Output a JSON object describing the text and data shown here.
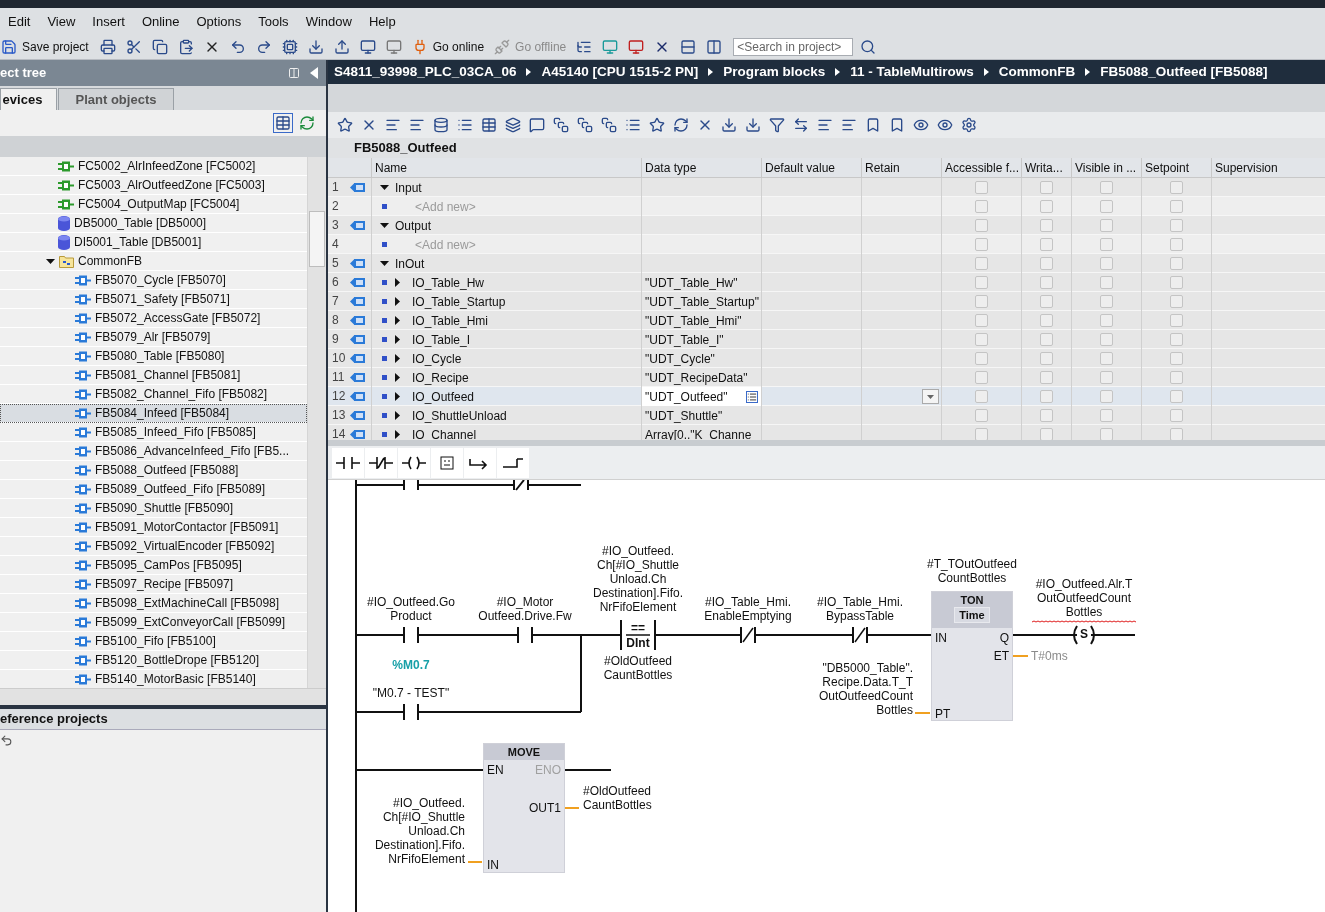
{
  "menu": [
    "Edit",
    "View",
    "Insert",
    "Online",
    "Options",
    "Tools",
    "Window",
    "Help"
  ],
  "toolbar": {
    "save": "Save project",
    "go_online": "Go online",
    "go_offline": "Go offline",
    "go_offline_disabled": true,
    "search_placeholder": "<Search in project>"
  },
  "project_tree": {
    "title": "ect tree",
    "tabs": [
      {
        "label": "evices",
        "selected": true
      },
      {
        "label": "Plant objects",
        "selected": false
      }
    ],
    "items": [
      {
        "kind": "fc",
        "label": "FC5002_AlrInfeedZone [FC5002]",
        "selected": false
      },
      {
        "kind": "fc",
        "label": "FC5003_AlrOutfeedZone [FC5003]",
        "selected": false
      },
      {
        "kind": "fc",
        "label": "FC5004_OutputMap [FC5004]",
        "selected": false
      },
      {
        "kind": "db",
        "label": "DB5000_Table [DB5000]",
        "selected": false
      },
      {
        "kind": "db",
        "label": "DI5001_Table [DB5001]",
        "selected": false
      },
      {
        "kind": "folder",
        "label": "CommonFB",
        "selected": false,
        "expanded": true,
        "children": [
          {
            "kind": "fb",
            "label": "FB5070_Cycle [FB5070]",
            "selected": false
          },
          {
            "kind": "fb",
            "label": "FB5071_Safety [FB5071]",
            "selected": false
          },
          {
            "kind": "fb",
            "label": "FB5072_AccessGate [FB5072]",
            "selected": false
          },
          {
            "kind": "fb",
            "label": "FB5079_Alr [FB5079]",
            "selected": false
          },
          {
            "kind": "fb",
            "label": "FB5080_Table [FB5080]",
            "selected": false
          },
          {
            "kind": "fb",
            "label": "FB5081_Channel [FB5081]",
            "selected": false
          },
          {
            "kind": "fb",
            "label": "FB5082_Channel_Fifo [FB5082]",
            "selected": false
          },
          {
            "kind": "fb",
            "label": "FB5084_Infeed [FB5084]",
            "selected": true
          },
          {
            "kind": "fb",
            "label": "FB5085_Infeed_Fifo [FB5085]",
            "selected": false
          },
          {
            "kind": "fb",
            "label": "FB5086_AdvanceInfeed_Fifo [FB5...",
            "selected": false
          },
          {
            "kind": "fb",
            "label": "FB5088_Outfeed [FB5088]",
            "selected": false
          },
          {
            "kind": "fb",
            "label": "FB5089_Outfeed_Fifo [FB5089]",
            "selected": false
          },
          {
            "kind": "fb",
            "label": "FB5090_Shuttle [FB5090]",
            "selected": false
          },
          {
            "kind": "fb",
            "label": "FB5091_MotorContactor [FB5091]",
            "selected": false
          },
          {
            "kind": "fb",
            "label": "FB5092_VirtualEncoder [FB5092]",
            "selected": false
          },
          {
            "kind": "fb",
            "label": "FB5095_CamPos [FB5095]",
            "selected": false
          },
          {
            "kind": "fb",
            "label": "FB5097_Recipe [FB5097]",
            "selected": false
          },
          {
            "kind": "fb",
            "label": "FB5098_ExtMachineCall [FB5098]",
            "selected": false
          },
          {
            "kind": "fb",
            "label": "FB5099_ExtConveyorCall [FB5099]",
            "selected": false
          },
          {
            "kind": "fb",
            "label": "FB5100_Fifo [FB5100]",
            "selected": false
          },
          {
            "kind": "fb",
            "label": "FB5120_BottleDrope [FB5120]",
            "selected": false
          },
          {
            "kind": "fb",
            "label": "FB5140_MotorBasic [FB5140]",
            "selected": false
          }
        ]
      }
    ],
    "reference_title": "eference projects"
  },
  "breadcrumb": [
    "S4811_93998_PLC_03CA_06",
    "A45140 [CPU 1515-2 PN]",
    "Program blocks",
    "11 - TableMultirows",
    "CommonFB",
    "FB5088_Outfeed [FB5088]"
  ],
  "block_title": "FB5088_Outfeed",
  "interface_table": {
    "columns": [
      "Name",
      "Data type",
      "Default value",
      "Retain",
      "Accessible f...",
      "Writa...",
      "Visible in ...",
      "Setpoint",
      "Supervision"
    ],
    "rows": [
      {
        "number": "1",
        "kind": "section",
        "name": "Input",
        "expanded": true,
        "flags": [
          false,
          false,
          false,
          false
        ],
        "selected": false
      },
      {
        "number": "2",
        "kind": "add",
        "name": "<Add new>",
        "flags": [
          false,
          false,
          false,
          false
        ],
        "selected": false
      },
      {
        "number": "3",
        "kind": "section",
        "name": "Output",
        "expanded": true,
        "flags": [
          false,
          false,
          false,
          false
        ],
        "selected": false
      },
      {
        "number": "4",
        "kind": "add",
        "name": "<Add new>",
        "flags": [
          false,
          false,
          false,
          false
        ],
        "selected": false
      },
      {
        "number": "5",
        "kind": "section",
        "name": "InOut",
        "expanded": true,
        "flags": [
          false,
          false,
          false,
          false
        ],
        "selected": false
      },
      {
        "number": "6",
        "kind": "member",
        "name": "IO_Table_Hw",
        "data_type": "\"UDT_Table_Hw\"",
        "expanded": false,
        "flags": [
          false,
          false,
          false,
          false
        ],
        "selected": false
      },
      {
        "number": "7",
        "kind": "member",
        "name": "IO_Table_Startup",
        "data_type": "\"UDT_Table_Startup\"",
        "expanded": false,
        "flags": [
          false,
          false,
          false,
          false
        ],
        "selected": false
      },
      {
        "number": "8",
        "kind": "member",
        "name": "IO_Table_Hmi",
        "data_type": "\"UDT_Table_Hmi\"",
        "expanded": false,
        "flags": [
          false,
          false,
          false,
          false
        ],
        "selected": false
      },
      {
        "number": "9",
        "kind": "member",
        "name": "IO_Table_I",
        "data_type": "\"UDT_Table_I\"",
        "expanded": false,
        "flags": [
          false,
          false,
          false,
          false
        ],
        "selected": false
      },
      {
        "number": "10",
        "kind": "member",
        "name": "IO_Cycle",
        "data_type": "\"UDT_Cycle\"",
        "expanded": false,
        "flags": [
          false,
          false,
          false,
          false
        ],
        "selected": false
      },
      {
        "number": "11",
        "kind": "member",
        "name": "IO_Recipe",
        "data_type": "\"UDT_RecipeData\"",
        "expanded": false,
        "flags": [
          false,
          false,
          false,
          false
        ],
        "selected": false
      },
      {
        "number": "12",
        "kind": "member",
        "name": "IO_Outfeed",
        "data_type": "\"UDT_Outfeed\"",
        "expanded": false,
        "flags": [
          false,
          false,
          false,
          false
        ],
        "selected": true
      },
      {
        "number": "13",
        "kind": "member",
        "name": "IO_ShuttleUnload",
        "data_type": "\"UDT_Shuttle\"",
        "expanded": false,
        "flags": [
          false,
          false,
          false,
          false
        ],
        "selected": false
      },
      {
        "number": "14",
        "kind": "member",
        "name": "IO_Channel",
        "data_type": "Array[0..\"K_Channe",
        "expanded": false,
        "flags": [
          false,
          false,
          false,
          false
        ],
        "selected": false
      }
    ]
  },
  "ladder": {
    "elements": [
      {
        "kind": "contact_no",
        "operand": [
          "#IO_Outfeed.Go",
          "Product"
        ]
      },
      {
        "kind": "contact_no",
        "operand": [
          "#IO_Motor",
          "Outfeed.Drive.Fw"
        ]
      },
      {
        "kind": "contact_no",
        "address": "%M0.7",
        "operand": [
          "\"M0.7 - TEST\""
        ]
      },
      {
        "kind": "compare",
        "operator": "==",
        "type": "DInt",
        "operand_top": [
          "#IO_Outfeed.",
          "Ch[#IO_Shuttle",
          "Unload.Ch",
          "Destination].Fifo.",
          "NrFifoElement"
        ],
        "operand_bottom": [
          "#OldOutfeed",
          "CauntBottles"
        ]
      },
      {
        "kind": "contact_nc",
        "operand": [
          "#IO_Table_Hmi.",
          "EnableEmptying"
        ]
      },
      {
        "kind": "contact_nc",
        "operand": [
          "#IO_Table_Hmi.",
          "BypassTable"
        ]
      },
      {
        "kind": "timer",
        "instance": [
          "#T_TOutOutfeed",
          "CountBottles"
        ],
        "name": "TON",
        "type": "Time",
        "pin_in": "IN",
        "pin_q": "Q",
        "pin_et": "ET",
        "pin_pt": "PT",
        "et_value": "T#0ms",
        "pt_value": [
          "\"DB5000_Table\".",
          "Recipe.Data.T_T",
          "OutOutfeedCount",
          "Bottles"
        ]
      },
      {
        "kind": "coil",
        "symbol": "S",
        "operand": [
          "#IO_Outfeed.Alr.T",
          "OutOutfeedCount",
          "Bottles"
        ],
        "error": true
      },
      {
        "kind": "move",
        "name": "MOVE",
        "pin_en": "EN",
        "pin_eno": "ENO",
        "pin_out": "OUT1",
        "pin_in": "IN",
        "in_value": [
          "#IO_Outfeed.",
          "Ch[#IO_Shuttle",
          "Unload.Ch",
          "Destination].Fifo.",
          "NrFifoElement"
        ],
        "out_value": [
          "#OldOutfeed",
          "CauntBottles"
        ]
      }
    ]
  }
}
